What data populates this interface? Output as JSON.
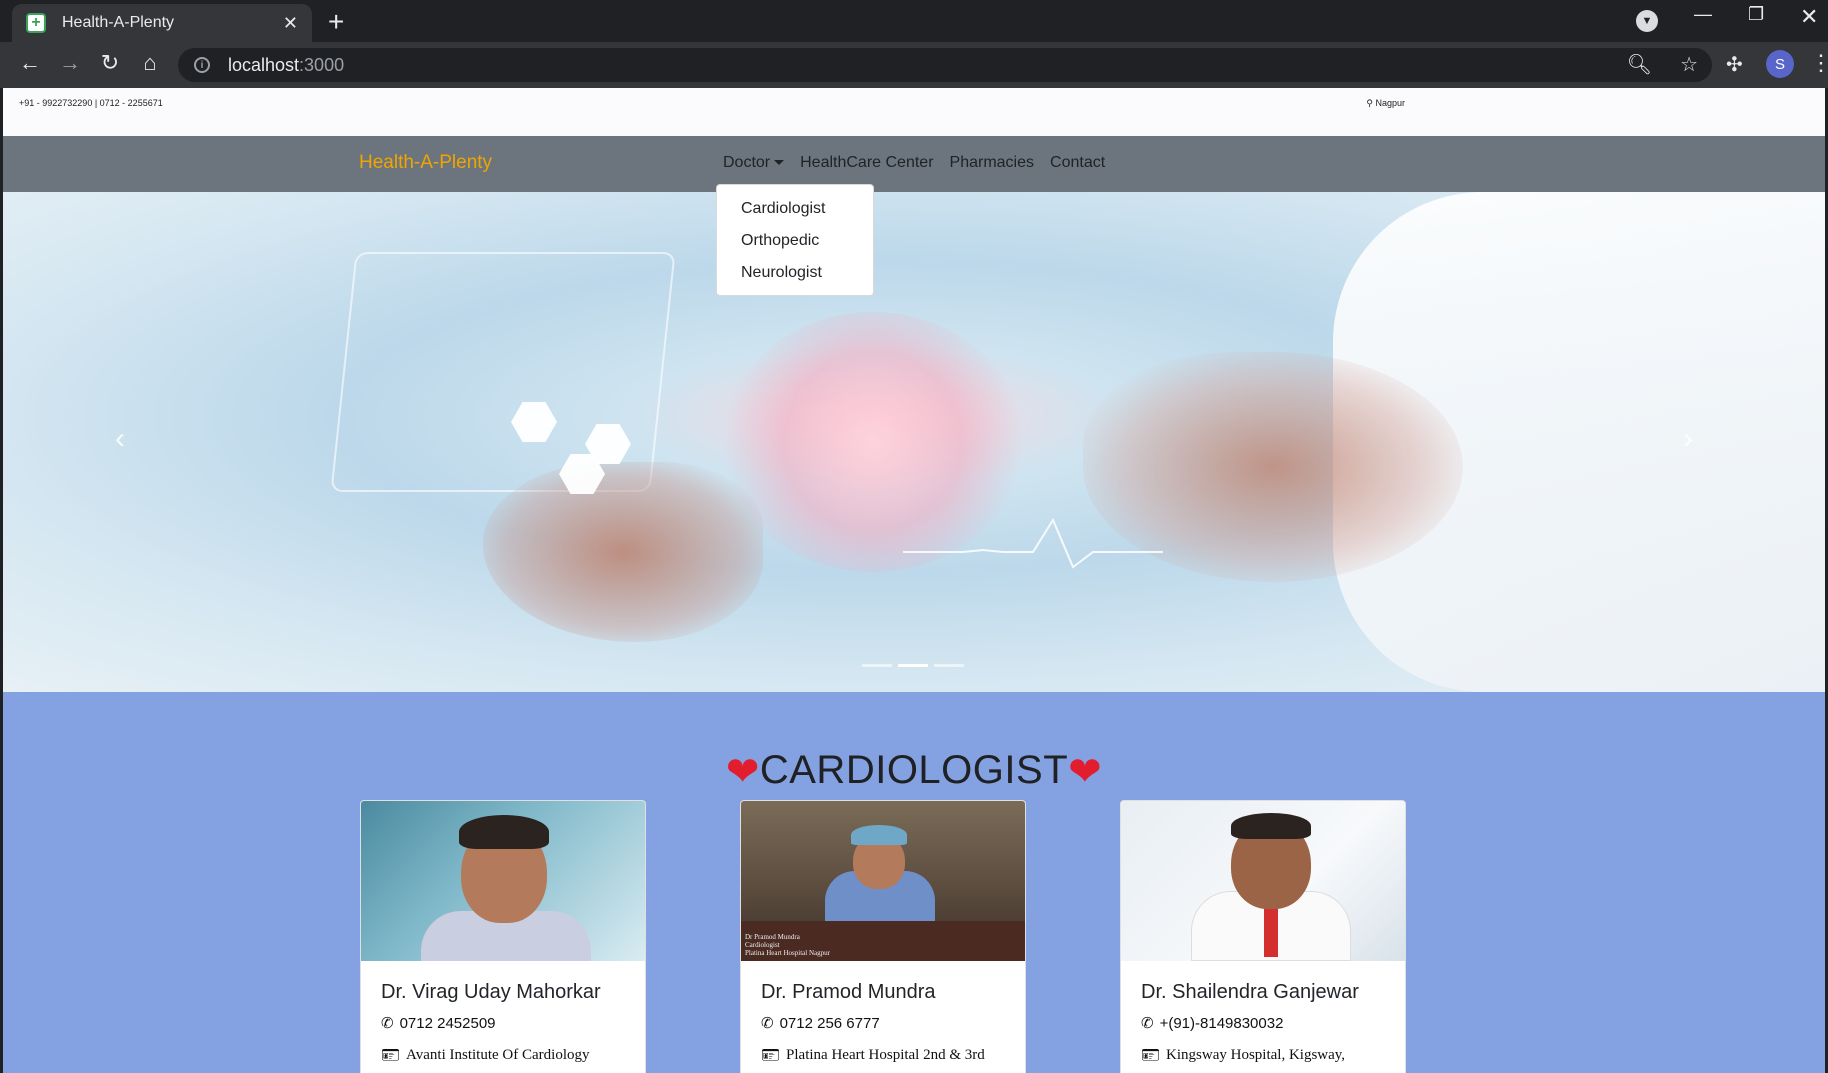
{
  "browser": {
    "tab_title": "Health-A-Plenty",
    "url_host": "localhost",
    "url_port": ":3000",
    "profile_initial": "S"
  },
  "topbar": {
    "phones": "+91 - 9922732290 | 0712 - 2255671",
    "location": "Nagpur"
  },
  "navbar": {
    "brand": "Health-A-Plenty",
    "links": {
      "doctor": "Doctor",
      "healthcare": "HealthCare Center",
      "pharmacies": "Pharmacies",
      "contact": "Contact"
    }
  },
  "dropdown": {
    "items": [
      "Cardiologist",
      "Orthopedic",
      "Neurologist"
    ]
  },
  "carousel": {
    "slides": 3,
    "active_index": 1
  },
  "section": {
    "title": "CARDIOLOGIST"
  },
  "doctors": [
    {
      "name": "Dr. Virag Uday Mahorkar",
      "phone": "0712 2452509",
      "address": "Avanti Institute Of Cardiology"
    },
    {
      "name": "Dr. Pramod Mundra",
      "phone": "0712 256 6777",
      "address": "Platina Heart Hospital 2nd & 3rd",
      "photo_caption": "Dr Pramod Mundra\nCardiologist\nPlatina Heart Hospital Nagpur"
    },
    {
      "name": "Dr. Shailendra Ganjewar",
      "phone": "+(91)-8149830032",
      "address": "Kingsway Hospital, Kigsway,"
    }
  ],
  "colors": {
    "brand": "#f0a500",
    "navbar_bg": "#6c757d",
    "section_bg": "#84a2e1",
    "heart": "#e11d2e"
  }
}
